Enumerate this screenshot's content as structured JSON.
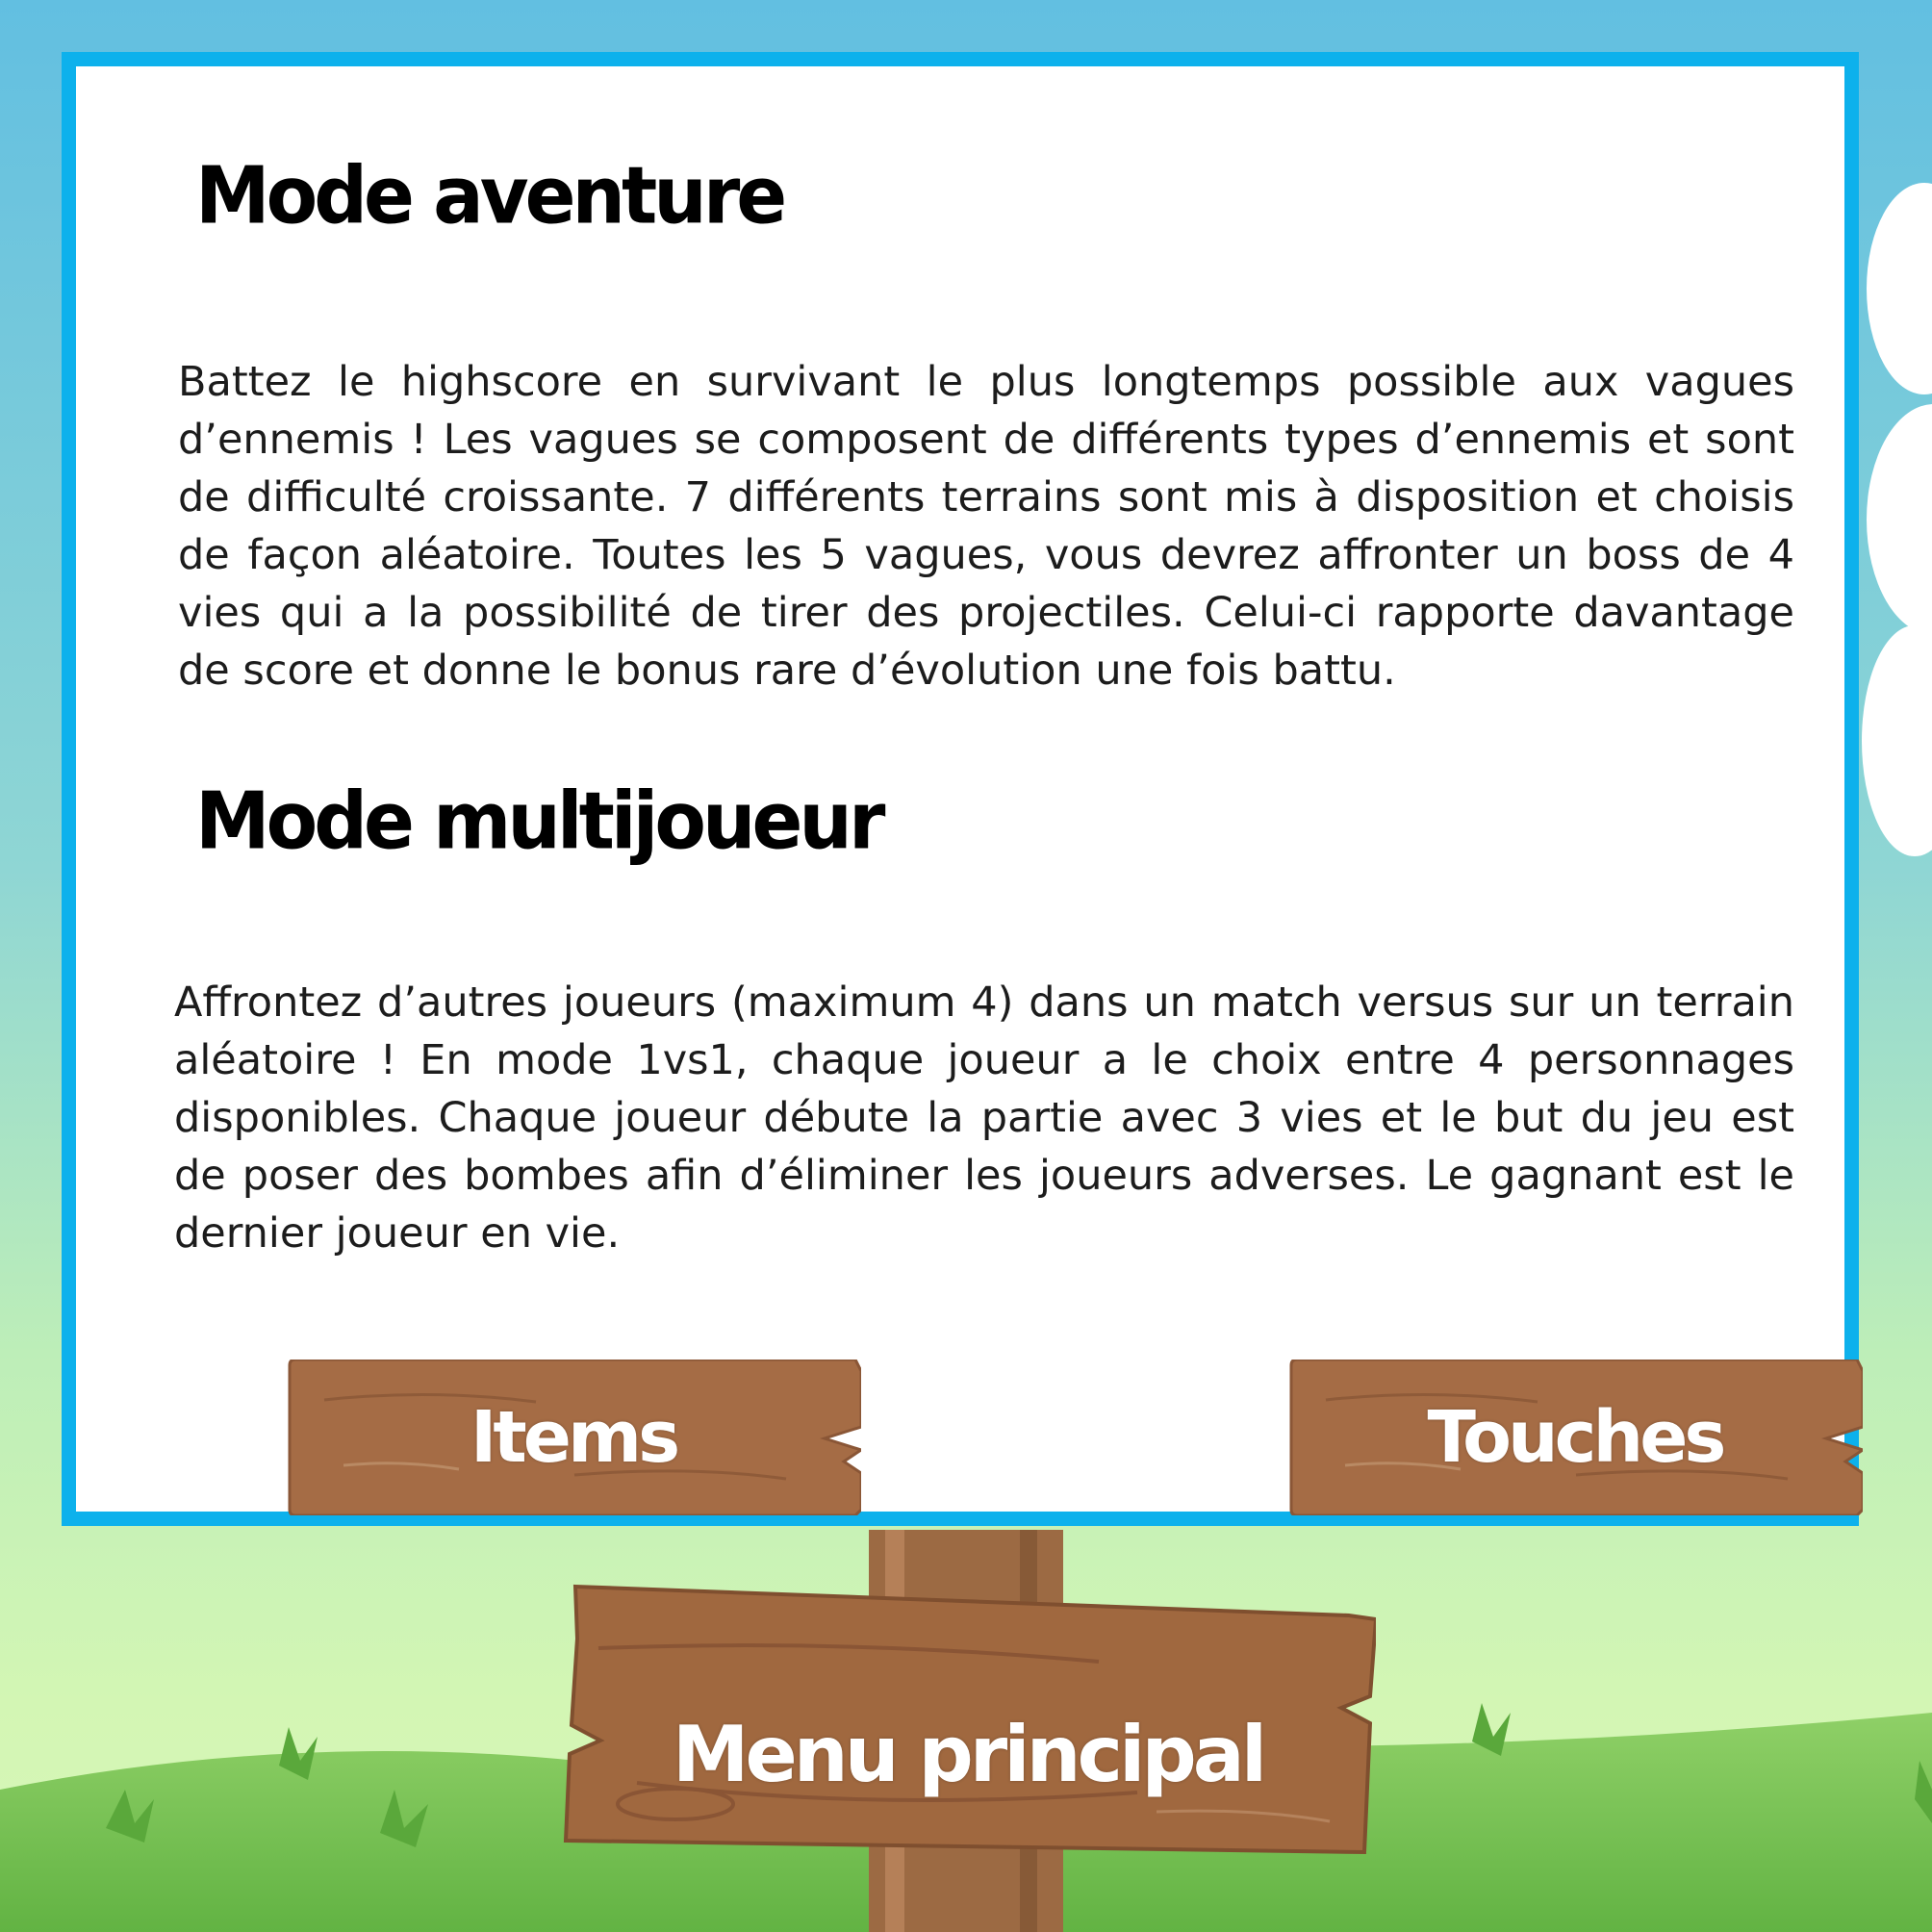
{
  "sections": {
    "aventure": {
      "title": "Mode aventure",
      "text": "Battez le highscore en survivant le plus longtemps possible aux vagues d’ennemis ! Les vagues se composent de différents types d’ennemis et sont de difficulté croissante. 7 différents terrains sont mis à disposition et choisis de façon aléatoire. Toutes les 5 vagues, vous devrez affronter un boss de 4 vies qui a la possibilité de tirer des projectiles. Celui-ci rapporte davantage de score et donne le bonus rare d’évolution une fois battu."
    },
    "multijoueur": {
      "title": "Mode multijoueur",
      "text": "Affrontez d’autres joueurs (maximum 4) dans un match versus sur un terrain aléatoire ! En mode 1vs1, chaque joueur a le choix entre 4 personnages disponibles. Chaque joueur débute la partie avec 3 vies et le but du jeu est de poser des bombes afin d’éliminer les joueurs adverses. Le gagnant est le dernier joueur en vie."
    }
  },
  "buttons": {
    "items": "Items",
    "touches": "Touches",
    "menu": "Menu principal"
  },
  "colors": {
    "panel_border": "#0db1ec",
    "wood": "#a26c45",
    "sky": "#62bfe1",
    "grass": "#6fbf4e"
  }
}
